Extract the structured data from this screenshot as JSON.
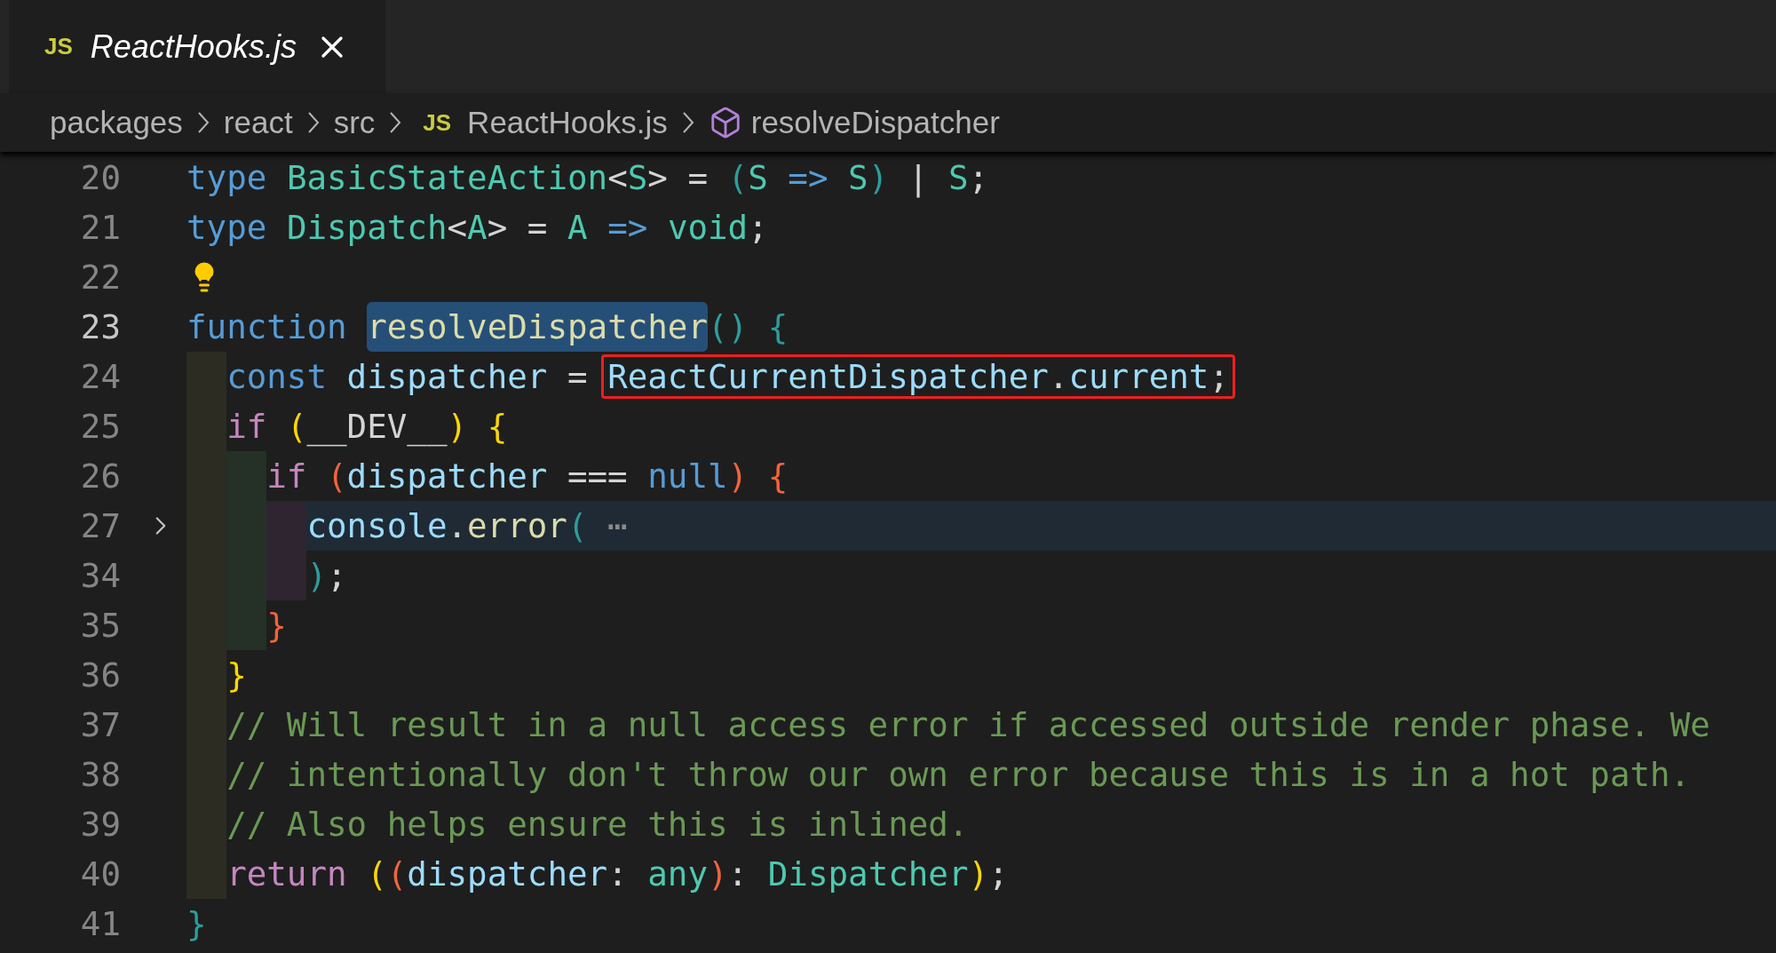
{
  "tabs": [
    {
      "icon_text": "JS",
      "label": "ReactHooks.js",
      "active": true,
      "preview": true
    }
  ],
  "breadcrumbs": [
    {
      "label": "packages",
      "kind": "folder"
    },
    {
      "label": "react",
      "kind": "folder"
    },
    {
      "label": "src",
      "kind": "folder"
    },
    {
      "label": "ReactHooks.js",
      "kind": "file",
      "icon_text": "JS"
    },
    {
      "label": "resolveDispatcher",
      "kind": "symbol"
    }
  ],
  "lines": [
    {
      "number": "20",
      "tokens": [
        {
          "text": "type ",
          "kind": "keyword"
        },
        {
          "text": "BasicStateAction",
          "kind": "type"
        },
        {
          "text": "<",
          "kind": "plain"
        },
        {
          "text": "S",
          "kind": "type"
        },
        {
          "text": "> = ",
          "kind": "plain"
        },
        {
          "text": "(",
          "kind": "bracket_teal"
        },
        {
          "text": "S ",
          "kind": "type"
        },
        {
          "text": "=> ",
          "kind": "keyword"
        },
        {
          "text": "S",
          "kind": "type"
        },
        {
          "text": ")",
          "kind": "bracket_teal"
        },
        {
          "text": " | ",
          "kind": "plain"
        },
        {
          "text": "S",
          "kind": "type"
        },
        {
          "text": ";",
          "kind": "plain"
        }
      ]
    },
    {
      "number": "21",
      "tokens": [
        {
          "text": "type ",
          "kind": "keyword"
        },
        {
          "text": "Dispatch",
          "kind": "type"
        },
        {
          "text": "<",
          "kind": "plain"
        },
        {
          "text": "A",
          "kind": "type"
        },
        {
          "text": "> = ",
          "kind": "plain"
        },
        {
          "text": "A ",
          "kind": "type"
        },
        {
          "text": "=> ",
          "kind": "keyword"
        },
        {
          "text": "void",
          "kind": "type"
        },
        {
          "text": ";",
          "kind": "plain"
        }
      ]
    },
    {
      "number": "22",
      "lightbulb": true
    },
    {
      "number": "23",
      "active": true,
      "tokens": [
        {
          "text": "function ",
          "kind": "keyword"
        },
        {
          "text": "resolveDispatcher",
          "kind": "function",
          "selected": true
        },
        {
          "text": "()",
          "kind": "bracket_teal"
        },
        {
          "text": " {",
          "kind": "bracket_teal"
        }
      ]
    },
    {
      "number": "24",
      "tokens": [
        {
          "text": "  const ",
          "kind": "keyword"
        },
        {
          "text": "dispatcher",
          "kind": "variable"
        },
        {
          "text": " = ",
          "kind": "plain"
        },
        {
          "text": "ReactCurrentDispatcher",
          "kind": "variable",
          "boxed": true
        },
        {
          "text": ".",
          "kind": "plain",
          "boxed": true
        },
        {
          "text": "current",
          "kind": "variable",
          "boxed": true
        },
        {
          "text": ";",
          "kind": "plain",
          "boxed": true
        }
      ]
    },
    {
      "number": "25",
      "tokens": [
        {
          "text": "  if ",
          "kind": "control"
        },
        {
          "text": "(",
          "kind": "bracket_gold"
        },
        {
          "text": "__DEV__",
          "kind": "plain"
        },
        {
          "text": ")",
          "kind": "bracket_gold"
        },
        {
          "text": " {",
          "kind": "bracket_gold"
        }
      ]
    },
    {
      "number": "26",
      "tokens": [
        {
          "text": "    if ",
          "kind": "control"
        },
        {
          "text": "(",
          "kind": "bracket_red"
        },
        {
          "text": "dispatcher",
          "kind": "variable"
        },
        {
          "text": " === ",
          "kind": "plain"
        },
        {
          "text": "null",
          "kind": "keyword"
        },
        {
          "text": ")",
          "kind": "bracket_red"
        },
        {
          "text": " {",
          "kind": "bracket_red"
        }
      ]
    },
    {
      "number": "27",
      "folded": true,
      "current": true,
      "tokens": [
        {
          "text": "      console",
          "kind": "variable"
        },
        {
          "text": ".",
          "kind": "plain"
        },
        {
          "text": "error",
          "kind": "function"
        },
        {
          "text": "(",
          "kind": "bracket_teal"
        },
        {
          "text": " ⋯",
          "kind": "ellipsis"
        }
      ]
    },
    {
      "number": "34",
      "tokens": [
        {
          "text": "      )",
          "kind": "bracket_teal"
        },
        {
          "text": ";",
          "kind": "plain"
        }
      ]
    },
    {
      "number": "35",
      "tokens": [
        {
          "text": "    }",
          "kind": "bracket_red"
        }
      ]
    },
    {
      "number": "36",
      "tokens": [
        {
          "text": "  }",
          "kind": "bracket_gold"
        }
      ]
    },
    {
      "number": "37",
      "tokens": [
        {
          "text": "  // Will result in a null access error if accessed outside render phase. We",
          "kind": "comment"
        }
      ]
    },
    {
      "number": "38",
      "tokens": [
        {
          "text": "  // intentionally don't throw our own error because this is in a hot path.",
          "kind": "comment"
        }
      ]
    },
    {
      "number": "39",
      "tokens": [
        {
          "text": "  // Also helps ensure this is inlined.",
          "kind": "comment"
        }
      ]
    },
    {
      "number": "40",
      "tokens": [
        {
          "text": "  return ",
          "kind": "control"
        },
        {
          "text": "(",
          "kind": "bracket_gold"
        },
        {
          "text": "(",
          "kind": "bracket_red"
        },
        {
          "text": "dispatcher",
          "kind": "variable"
        },
        {
          "text": ": ",
          "kind": "plain"
        },
        {
          "text": "any",
          "kind": "type"
        },
        {
          "text": ")",
          "kind": "bracket_red"
        },
        {
          "text": ": ",
          "kind": "plain"
        },
        {
          "text": "Dispatcher",
          "kind": "type"
        },
        {
          "text": ")",
          "kind": "bracket_gold"
        },
        {
          "text": ";",
          "kind": "plain"
        }
      ]
    },
    {
      "number": "41",
      "tokens": [
        {
          "text": "}",
          "kind": "bracket_teal"
        }
      ]
    }
  ]
}
